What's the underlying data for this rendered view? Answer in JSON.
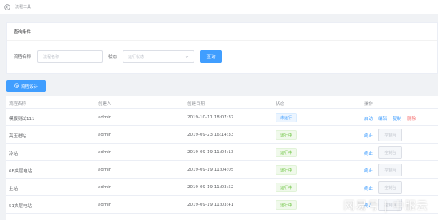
{
  "app": {
    "title": "流程工具"
  },
  "query": {
    "header": "查询条件",
    "name_label": "流程名称",
    "name_placeholder": "流程名称",
    "status_label": "状态",
    "status_placeholder": "运行状态",
    "search_button": "查询"
  },
  "toolbar": {
    "add_label": "流程设计"
  },
  "table": {
    "columns": [
      "流程名称",
      "创建人",
      "创建日期",
      "状态",
      "操作"
    ],
    "rows": [
      {
        "name": "模版测试111",
        "creator": "admin",
        "date": "2019-10-11 18:07:37",
        "status": "未运行",
        "status_type": "idle",
        "ops": [
          "启动",
          "编辑",
          "复制",
          "删除"
        ]
      },
      {
        "name": "高压进站",
        "creator": "admin",
        "date": "2019-09-23 16:14:33",
        "status": "运行中",
        "status_type": "run",
        "ops": [
          "终止",
          "控制台"
        ]
      },
      {
        "name": "冷站",
        "creator": "admin",
        "date": "2019-09-19 11:04:13",
        "status": "运行中",
        "status_type": "run",
        "ops": [
          "终止",
          "控制台"
        ]
      },
      {
        "name": "6B夹层电站",
        "creator": "admin",
        "date": "2019-09-19 11:04:05",
        "status": "运行中",
        "status_type": "run",
        "ops": [
          "终止",
          "控制台"
        ]
      },
      {
        "name": "主站",
        "creator": "admin",
        "date": "2019-09-19 11:03:52",
        "status": "运行中",
        "status_type": "run",
        "ops": [
          "终止",
          "控制台"
        ]
      },
      {
        "name": "51夹层电站",
        "creator": "admin",
        "date": "2019-09-19 11:03:41",
        "status": "运行中",
        "status_type": "run",
        "ops": [
          "终止",
          "控制台"
        ]
      }
    ]
  },
  "watermark": "网易号 | 中服云",
  "colors": {
    "primary": "#409eff",
    "success": "#67c23a",
    "danger": "#f56c6c"
  }
}
